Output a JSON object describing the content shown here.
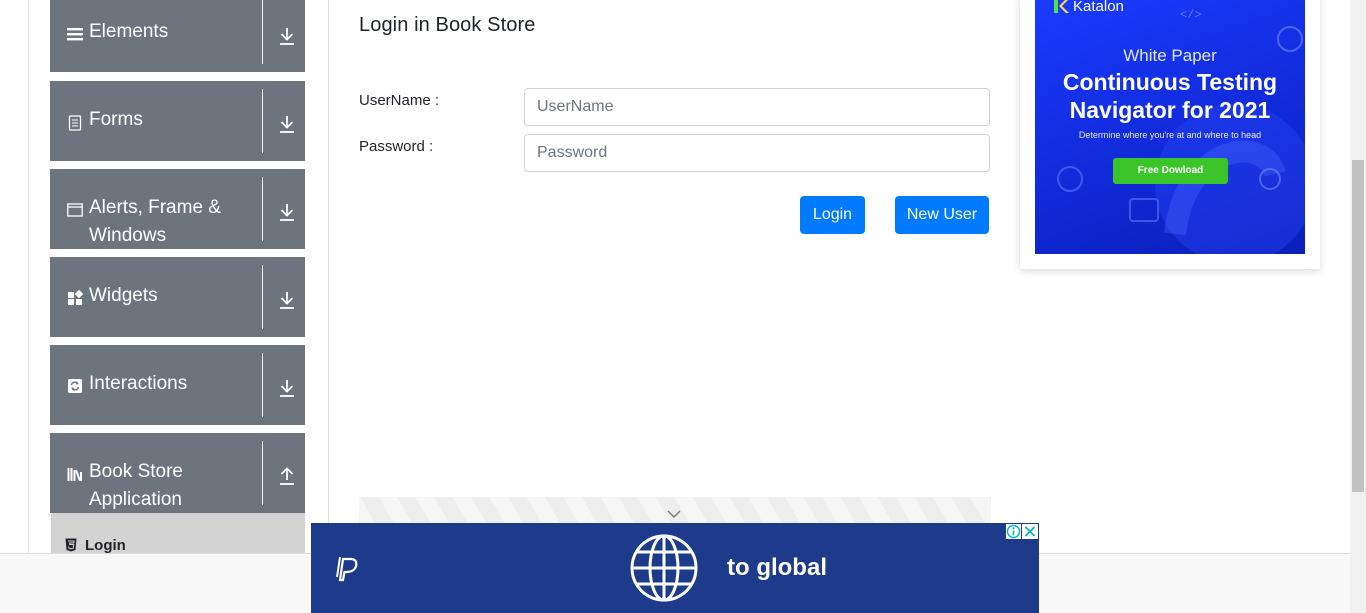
{
  "sidebar": {
    "groups": [
      {
        "label": "Elements",
        "icon": "menu-icon",
        "arrow": "download-arrow-icon"
      },
      {
        "label": "Forms",
        "icon": "form-icon",
        "arrow": "download-arrow-icon"
      },
      {
        "label": "Alerts, Frame & Windows",
        "icon": "window-icon",
        "arrow": "download-arrow-icon"
      },
      {
        "label": "Widgets",
        "icon": "widgets-icon",
        "arrow": "download-arrow-icon"
      },
      {
        "label": "Interactions",
        "icon": "interactions-icon",
        "arrow": "download-arrow-icon"
      },
      {
        "label": "Book Store Application",
        "icon": "books-icon",
        "arrow": "upload-arrow-icon"
      }
    ],
    "active_item": {
      "label": "Login",
      "icon": "html5-icon"
    }
  },
  "main": {
    "title": "Login in Book Store",
    "username_label": "UserName :",
    "username_placeholder": "UserName",
    "username_value": "",
    "password_label": "Password :",
    "password_placeholder": "Password",
    "password_value": "",
    "login_button": "Login",
    "new_user_button": "New User"
  },
  "right_ad": {
    "brand": "Katalon",
    "kicker": "White Paper",
    "headline_line1": "Continuous Testing",
    "headline_line2": "Navigator for 2021",
    "subtext": "Determine where you're at and where to head",
    "cta": "Free Dowload"
  },
  "bottom_ad": {
    "text": "to global",
    "brand_icon": "paypal-icon"
  },
  "colors": {
    "sidebar_group_bg": "#6c757d",
    "active_item_bg": "#d3d3d3",
    "primary_button": "#007bff",
    "ad_blue": "#1a3cff",
    "ad_cta_green": "#3bc52a",
    "bottom_ad_bg": "#1e3a8a"
  }
}
